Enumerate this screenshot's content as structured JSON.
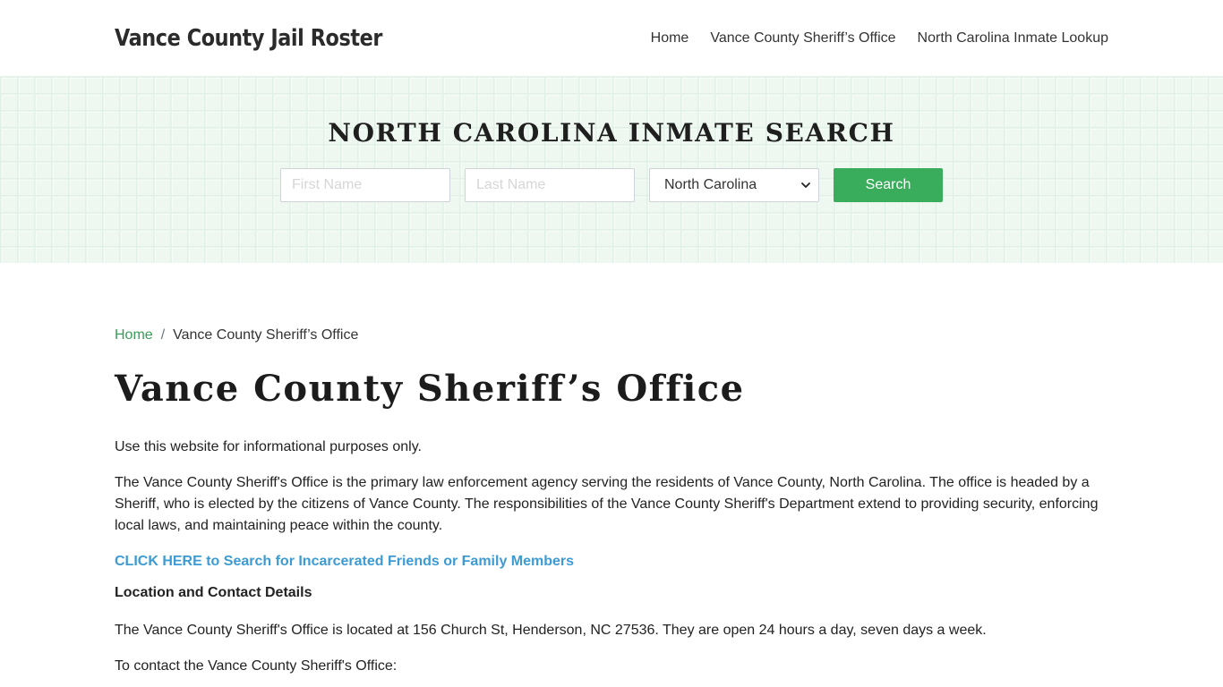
{
  "header": {
    "brand": "Vance County Jail Roster",
    "nav": [
      {
        "label": "Home"
      },
      {
        "label": "Vance County Sheriff’s Office"
      },
      {
        "label": "North Carolina Inmate Lookup"
      }
    ]
  },
  "hero": {
    "title": "NORTH CAROLINA INMATE SEARCH",
    "first_name_placeholder": "First Name",
    "last_name_placeholder": "Last Name",
    "state_selected": "North Carolina",
    "search_label": "Search",
    "colors": {
      "button": "#3aad5c",
      "background": "#eef8f1"
    }
  },
  "breadcrumb": {
    "home": "Home",
    "separator": "/",
    "current": "Vance County Sheriff’s Office"
  },
  "main": {
    "title": "Vance County Sheriff’s Office",
    "intro": "Use this website for informational purposes only.",
    "description": "The Vance County Sheriff's Office is the primary law enforcement agency serving the residents of Vance County, North Carolina. The office is headed by a Sheriff, who is elected by the citizens of Vance County. The responsibilities of the Vance County Sheriff's Department extend to providing security, enforcing local laws, and maintaining peace within the county.",
    "cta_link": "CLICK HERE to Search for Incarcerated Friends or Family Members",
    "location_heading": "Location and Contact Details",
    "location_text": "The Vance County Sheriff's Office is located at 156 Church St, Henderson, NC 27536. They are open 24 hours a day, seven days a week.",
    "contact_intro": "To contact the Vance County Sheriff's Office:"
  }
}
